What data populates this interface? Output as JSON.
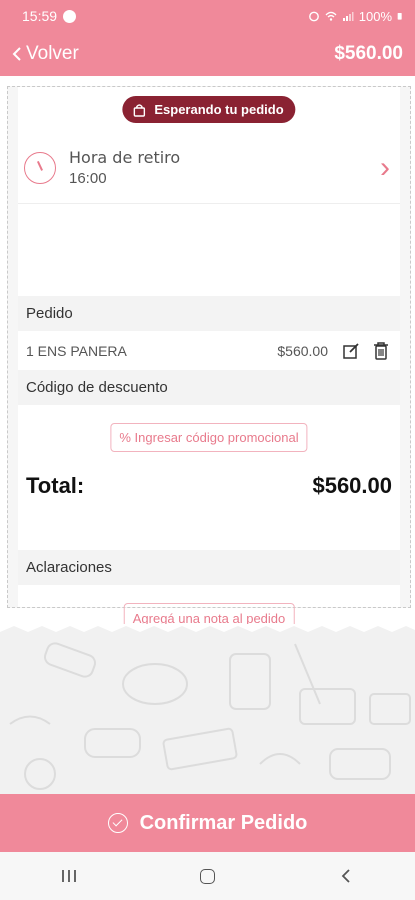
{
  "status_bar": {
    "time": "15:59",
    "battery": "100%"
  },
  "header": {
    "back_label": "Volver",
    "total": "$560.00"
  },
  "order": {
    "status_badge": "Esperando tu pedido",
    "pickup_label": "Hora de retiro",
    "pickup_time": "16:00",
    "section_pedido": "Pedido",
    "items": [
      {
        "name": "1 ENS PANERA",
        "price": "$560.00"
      }
    ],
    "section_discount": "Código de descuento",
    "promo_button": "% Ingresar código promocional",
    "total_label": "Total:",
    "total_value": "$560.00",
    "section_notes": "Aclaraciones",
    "note_button": "Agregá una nota al pedido"
  },
  "confirm_button": "Confirmar Pedido",
  "nav": {
    "recent": "recent-apps",
    "home": "home",
    "back": "back"
  },
  "colors": {
    "primary": "#f0899a",
    "badge": "#8a2232",
    "accent_text": "#e87a8c"
  }
}
